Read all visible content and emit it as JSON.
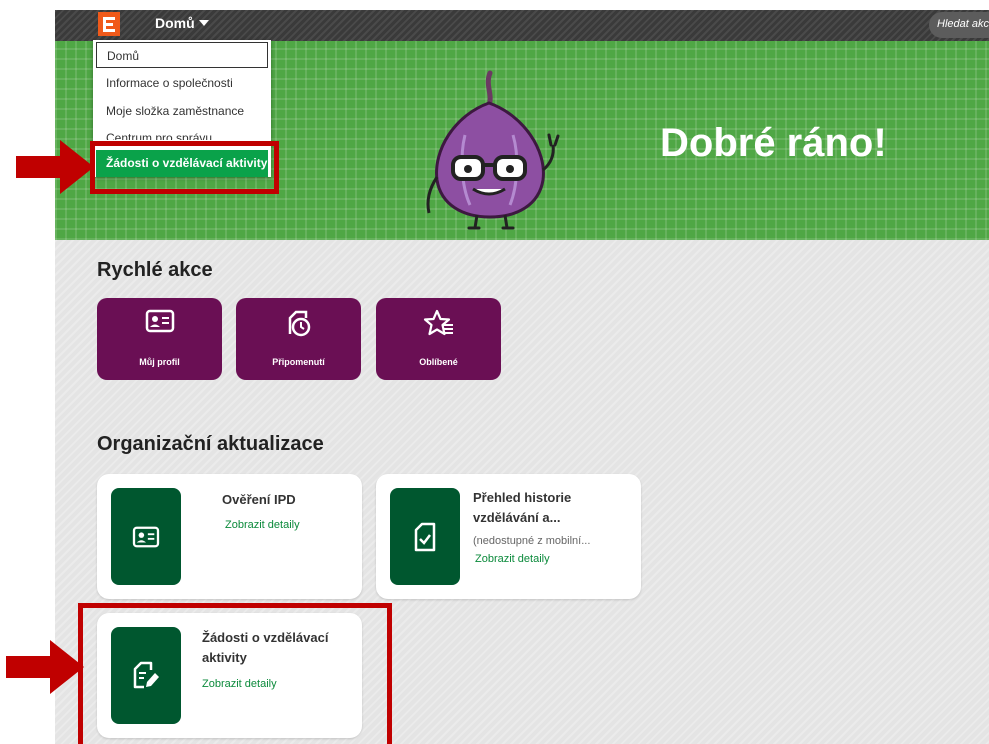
{
  "topbar": {
    "menu_label": "Domů",
    "search_placeholder": "Hledat akce"
  },
  "dropdown": {
    "items": [
      {
        "label": "Domů"
      },
      {
        "label": "Informace o společnosti"
      },
      {
        "label": "Moje složka zaměstnance"
      },
      {
        "label": "Centrum pro správu"
      },
      {
        "label": "Žádosti o vzdělávací aktivity"
      }
    ]
  },
  "banner": {
    "greeting": "Dobré ráno!"
  },
  "quick_actions": {
    "title": "Rychlé akce",
    "items": [
      {
        "label": "Můj profil",
        "icon": "profile-card-icon"
      },
      {
        "label": "Připomenutí",
        "icon": "reminder-icon"
      },
      {
        "label": "Oblíbené",
        "icon": "favorites-icon"
      }
    ]
  },
  "org_updates": {
    "title": "Organizační aktualizace",
    "cards": [
      {
        "title": "Ověření IPD",
        "subtitle": "",
        "link": "Zobrazit detaily",
        "icon": "profile-card-icon"
      },
      {
        "title": "Přehled historie vzdělávání a...",
        "subtitle": "(nedostupné z mobilní...",
        "link": "Zobrazit detaily",
        "icon": "document-check-icon"
      },
      {
        "title": "Žádosti o vzdělávací aktivity",
        "subtitle": "",
        "link": "Zobrazit detaily",
        "icon": "document-edit-icon"
      }
    ]
  },
  "colors": {
    "brand_orange": "#f05a1a",
    "banner_green": "#4fa745",
    "quick_action_purple": "#6a0f54",
    "card_icon_green": "#00572f",
    "active_menu_green": "#0aa24a",
    "annotation_red": "#c00000"
  }
}
